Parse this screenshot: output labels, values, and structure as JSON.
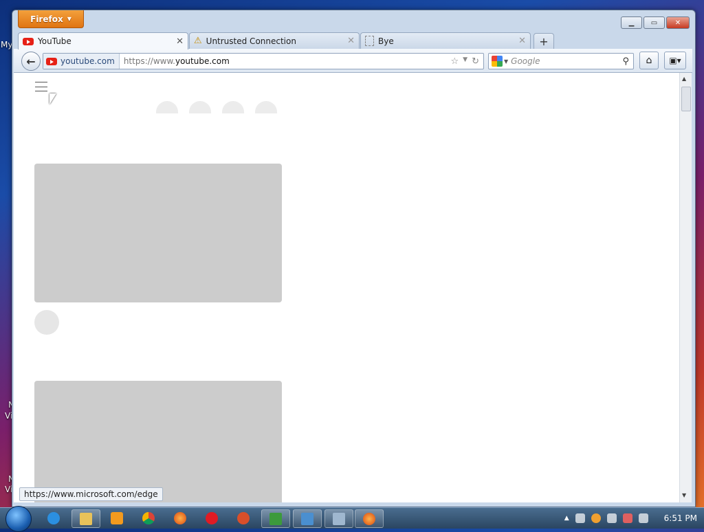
{
  "window": {
    "menu_button": "Firefox",
    "controls": {
      "minimize": "▁",
      "maximize": "▭",
      "close": "✕"
    }
  },
  "tabs": [
    {
      "label": "YouTube",
      "icon": "youtube-icon",
      "active": true
    },
    {
      "label": "Untrusted Connection",
      "icon": "warning-icon",
      "active": false
    },
    {
      "label": "Bye",
      "icon": "blank-page-icon",
      "active": false
    }
  ],
  "navbar": {
    "identity": "youtube.com",
    "url_prefix": "https://www.",
    "url_domain": "youtube.com",
    "search_placeholder": "Google"
  },
  "status": {
    "link_url": "https://www.microsoft.com/edge"
  },
  "taskbar": {
    "apps": [
      "internet-explorer-icon",
      "file-explorer-icon",
      "media-player-icon",
      "chrome-icon",
      "firefox-icon",
      "opera-icon",
      "app-icon",
      "csharp-icon",
      "app-icon",
      "app-icon",
      "firefox-icon"
    ],
    "clock": "6:51 PM"
  },
  "desktop": {
    "labels": [
      "My",
      "N",
      "Vi",
      "N",
      "Vi"
    ]
  },
  "colors": {
    "youtube_red": "#e62117",
    "firefox_orange": "#e07412",
    "placeholder_gray": "#cccccc"
  }
}
